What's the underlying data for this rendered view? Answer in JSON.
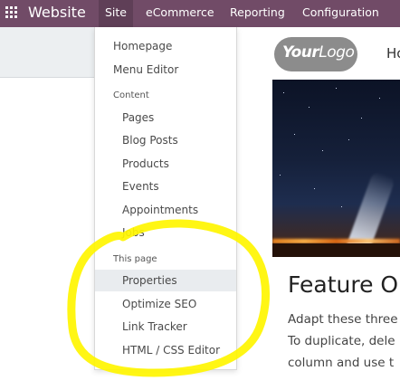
{
  "navbar": {
    "app_name": "Website",
    "menus": [
      {
        "label": "Site",
        "active": true
      },
      {
        "label": "eCommerce",
        "active": false
      },
      {
        "label": "Reporting",
        "active": false
      },
      {
        "label": "Configuration",
        "active": false
      }
    ],
    "bg_color": "#714b67"
  },
  "dropdown": {
    "top_items": [
      "Homepage",
      "Menu Editor"
    ],
    "content_header": "Content",
    "content_items": [
      "Pages",
      "Blog Posts",
      "Products",
      "Events",
      "Appointments",
      "Jobs"
    ],
    "page_header": "This page",
    "page_items": [
      "Properties",
      "Optimize SEO",
      "Link Tracker",
      "HTML / CSS Editor"
    ],
    "highlighted_item": "Properties"
  },
  "preview": {
    "logo_strong": "Your",
    "logo_light": "Logo",
    "nav_cut": "Ho",
    "feature_title": "Feature O",
    "feature_lines": [
      "Adapt these three",
      "To duplicate, dele",
      "column and use t"
    ]
  },
  "annotation": {
    "marker_color": "#fff500"
  }
}
